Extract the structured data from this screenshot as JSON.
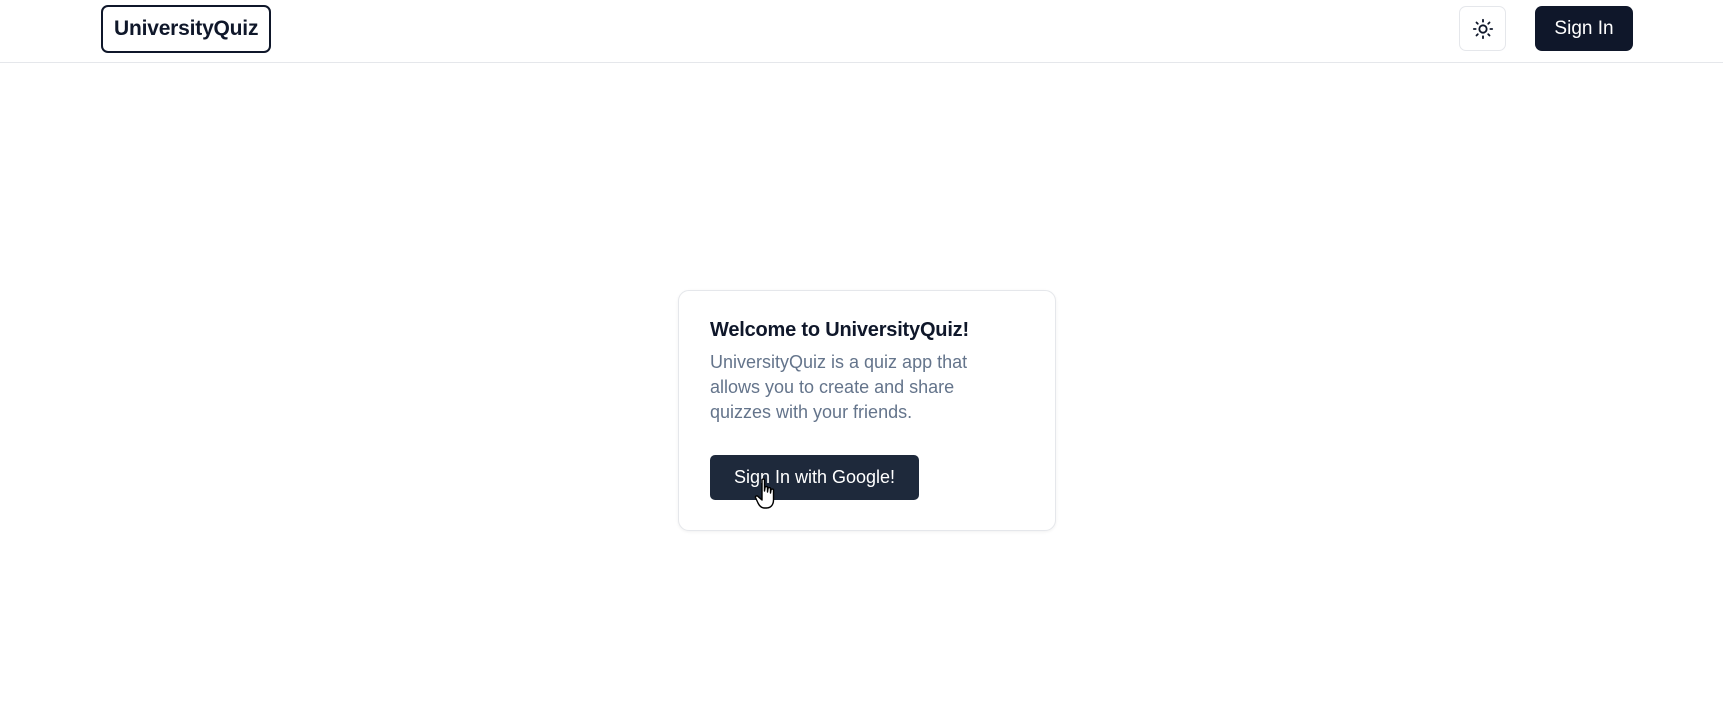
{
  "header": {
    "logo_text": "UniversityQuiz",
    "theme_toggle_icon": "sun-icon",
    "signin_label": "Sign In"
  },
  "welcome_card": {
    "title": "Welcome to UniversityQuiz!",
    "description": "UniversityQuiz is a quiz app that allows you to create and share quizzes with your friends.",
    "google_button_label": "Sign In with Google!"
  },
  "colors": {
    "primary_dark": "#0f172a",
    "button_dark": "#1e293b",
    "muted_text": "#64748b",
    "border": "#e5e7eb"
  }
}
